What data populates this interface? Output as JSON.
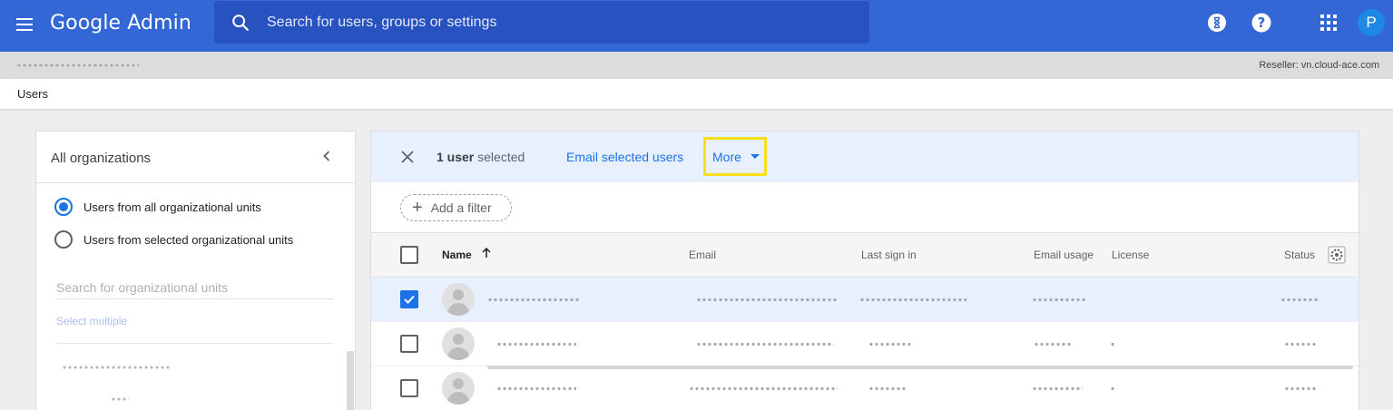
{
  "appbar": {
    "logo_text": "Google Admin",
    "search_placeholder": "Search for users, groups or settings",
    "avatar_letter": "P",
    "icons": [
      "menu-icon",
      "search-icon",
      "hourglass-icon",
      "help-icon",
      "apps-grid-icon"
    ],
    "bg_color": "#3367d6"
  },
  "strip": {
    "reseller_text": "Reseller: vn.cloud-ace.com"
  },
  "breadcrumb": {
    "current": "Users"
  },
  "left_panel": {
    "title": "All organizations",
    "radio_all": "Users from all organizational units",
    "radio_selected": "Users from selected organizational units",
    "ou_search_placeholder": "Search for organizational units",
    "select_multiple": "Select multiple"
  },
  "selection_bar": {
    "count_strong": "1 user",
    "count_rest": " selected",
    "email_selected": "Email selected users",
    "more": "More"
  },
  "filter": {
    "add_filter": "Add a filter"
  },
  "table": {
    "columns": {
      "name": "Name",
      "email": "Email",
      "last_sign_in": "Last sign in",
      "email_usage": "Email usage",
      "license": "License",
      "status": "Status"
    },
    "rows": [
      {
        "selected": true
      },
      {
        "selected": false
      },
      {
        "selected": false
      }
    ]
  },
  "colors": {
    "accent": "#1a73e8",
    "highlight": "#f7e01a",
    "selected_row": "#e8f0fe"
  }
}
